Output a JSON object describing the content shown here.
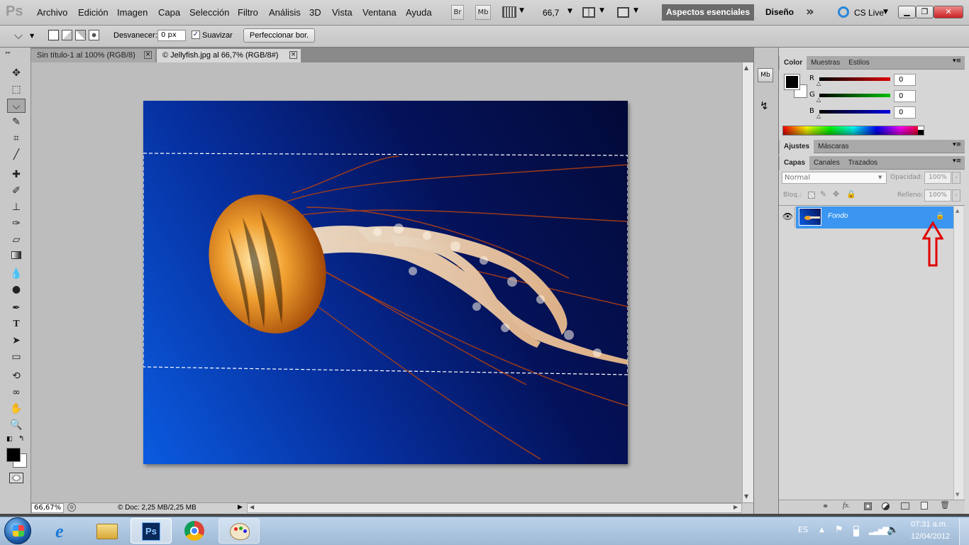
{
  "app": {
    "logo": "Ps"
  },
  "menu": [
    "Archivo",
    "Edición",
    "Imagen",
    "Capa",
    "Selección",
    "Filtro",
    "Análisis",
    "3D",
    "Vista",
    "Ventana",
    "Ayuda"
  ],
  "appbar": {
    "br": "Br",
    "mb": "Mb",
    "zoom": "66,7",
    "workspace_active": "Aspectos esenciales",
    "workspace_2": "Diseño",
    "more": "»",
    "cslive": "CS Live"
  },
  "options": {
    "desvanecer_label": "Desvanecer:",
    "desvanecer_value": "0 px",
    "suavizar_label": "Suavizar",
    "suavizar_checked": true,
    "refine_button": "Perfeccionar bor."
  },
  "tabs": [
    {
      "label": "Sin título-1 al 100% (RGB/8)",
      "close": "×"
    },
    {
      "label": "© Jellyfish.jpg al 66,7% (RGB/8#)",
      "close": "×"
    }
  ],
  "status": {
    "zoom": "66,67%",
    "doc": "© Doc: 2,25 MB/2,25 MB"
  },
  "color_panel": {
    "tabs": [
      "Color",
      "Muestras",
      "Estilos"
    ],
    "channels": [
      {
        "label": "R",
        "value": "0",
        "color": "#e00000"
      },
      {
        "label": "G",
        "value": "0",
        "color": "#00b000"
      },
      {
        "label": "B",
        "value": "0",
        "color": "#0000d0"
      }
    ]
  },
  "adjust_panel": {
    "tabs": [
      "Ajustes",
      "Máscaras"
    ]
  },
  "layers_panel": {
    "tabs": [
      "Capas",
      "Canales",
      "Trazados"
    ],
    "blend_mode": "Normal",
    "opacity_label": "Opacidad:",
    "opacity_value": "100%",
    "lock_label": "Bloq.:",
    "fill_label": "Relleno:",
    "fill_value": "100%",
    "layers": [
      {
        "name": "Fondo",
        "locked": true
      }
    ]
  },
  "taskbar": {
    "lang": "ES",
    "time": "07:31 a.m.",
    "date": "12/04/2012"
  },
  "colors": {
    "accent_selected": "#3a96f0",
    "annotation_arrow": "#e00000",
    "image_deep": "#030a38"
  }
}
